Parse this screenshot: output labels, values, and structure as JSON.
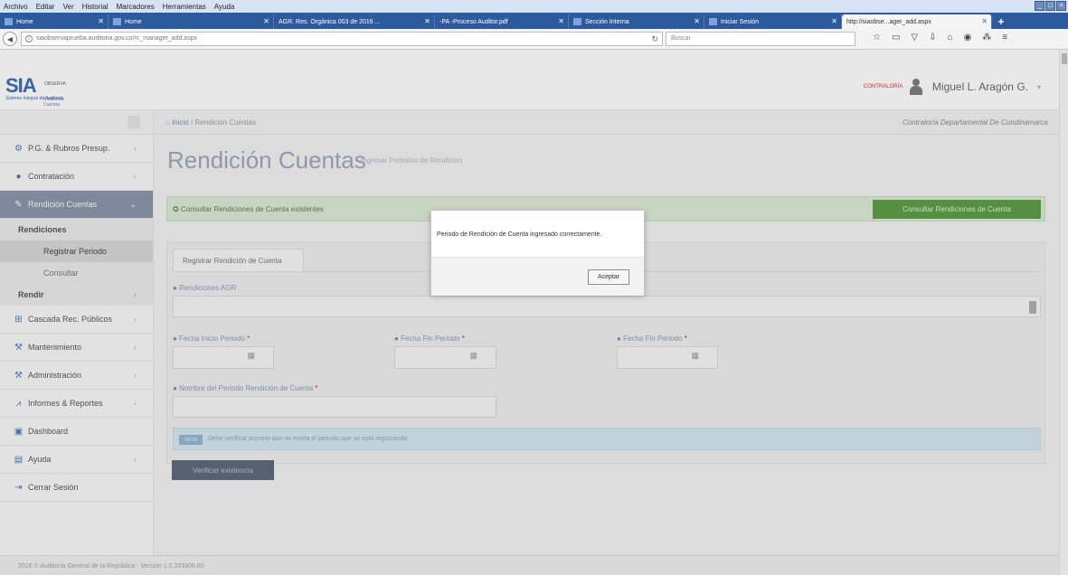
{
  "browser": {
    "menu": [
      "Archivo",
      "Editar",
      "Ver",
      "Historial",
      "Marcadores",
      "Herramientas",
      "Ayuda"
    ],
    "tabs": [
      {
        "label": "Home"
      },
      {
        "label": "Home"
      },
      {
        "label": "AGR. Res. Orgánica 003 de 2016 ..."
      },
      {
        "label": "-PA -Proceso Auditor.pdf"
      },
      {
        "label": "Sección Interna"
      },
      {
        "label": "Iniciar Sesión"
      },
      {
        "label": "http://siaobse...ager_add.aspx"
      }
    ],
    "url": "siaobservaprueba.auditoria.gov.co/rc_manager_add.aspx",
    "search_placeholder": "Buscar"
  },
  "header": {
    "logo_text": "SIA",
    "logo_subtitle": "Sistema Integral de Auditoría",
    "logo_side": "OBSERVA",
    "logo_side2": "Rindiendo Cuentas",
    "contraloria_label": "CONTRALORÍA",
    "user_name": "Miguel L. Aragón G."
  },
  "sidebar": {
    "items": [
      {
        "label": "P.G. & Rubros Presup.",
        "icon": "cogs-icon",
        "glyph": "⚙"
      },
      {
        "label": "Contratación",
        "icon": "circle-icon",
        "glyph": "●"
      },
      {
        "label": "Rendición Cuentas",
        "icon": "edit-icon",
        "glyph": "✎"
      }
    ],
    "submenu": {
      "group": "Rendiciones",
      "links": [
        "Registrar Periodo",
        "Consultar"
      ],
      "rendir": "Rendir"
    },
    "items_after": [
      {
        "label": "Cascada Rec. Públicos",
        "icon": "grid-icon",
        "glyph": "⊞"
      },
      {
        "label": "Mantenimiento",
        "icon": "wrench-icon",
        "glyph": "⚒"
      },
      {
        "label": "Administración",
        "icon": "wrench-icon",
        "glyph": "⚒"
      },
      {
        "label": "Informes & Reportes",
        "icon": "chart-icon",
        "glyph": "⩘"
      },
      {
        "label": "Dashboard",
        "icon": "dashboard-icon",
        "glyph": "▣"
      },
      {
        "label": "Ayuda",
        "icon": "book-icon",
        "glyph": "▤"
      },
      {
        "label": "Cerrar Sesión",
        "icon": "logout-icon",
        "glyph": "⇥"
      }
    ]
  },
  "content": {
    "breadcrumb_home": "Inicio",
    "breadcrumb_sep": "/",
    "breadcrumb_current": "Rendición Cuentas",
    "org_name": "Contraloría Departamental De Cundinamarca",
    "title": "Rendición Cuentas",
    "subtitle": "Ingresar Periodos de Rendicion",
    "alert_text": "Consultar Rendiciones de Cuenta existentes",
    "consult_button": "Consultar Rendiciones de Cuenta",
    "form_tab": "Registrar Rendición de Cuenta",
    "rendiciones_label": "Rendiciones AGR",
    "fecha_inicio_label": "Fecha Inicio Periodo",
    "fecha_fin_label": "Fecha Fin Periodo",
    "fecha_fin2_label": "Fecha Fin Periodo",
    "nombre_label": "Nombre del Periodo Rendición de Cuenta",
    "required_mark": "*",
    "note_badge": "NOTA",
    "note_text": "Debe verificar primero que no exista el periodo que se está registrando",
    "verify_button": "Verificar existencia"
  },
  "footer": {
    "text": "2016 © Auditoría General de la República - Versión 1.0.201606.60"
  },
  "modal": {
    "message": "Periodo de Rendición de Cuenta ingresado correctamente.",
    "accept_label": "Aceptar"
  }
}
